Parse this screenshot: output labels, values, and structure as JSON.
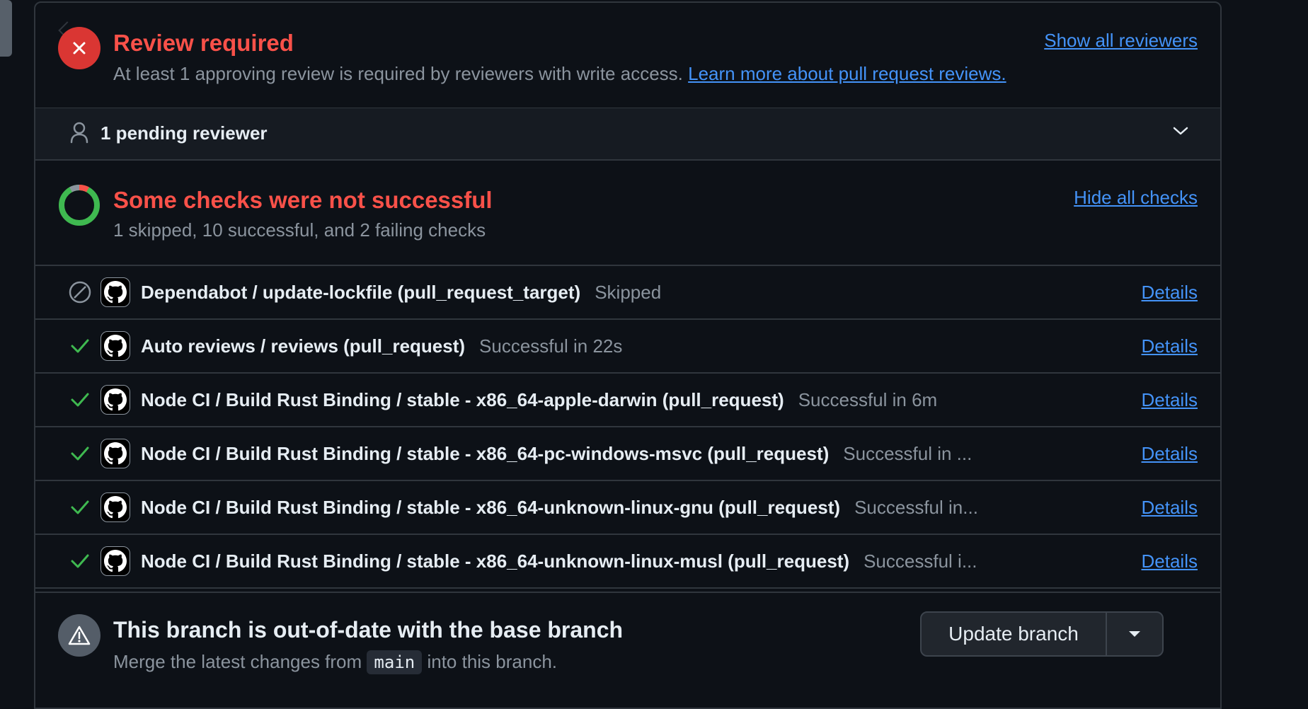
{
  "review": {
    "title": "Review required",
    "description": "At least 1 approving review is required by reviewers with write access.",
    "learn_more": "Learn more about pull request reviews.",
    "show_all": "Show all reviewers",
    "pending": "1 pending reviewer"
  },
  "checks": {
    "title": "Some checks were not successful",
    "summary": "1 skipped, 10 successful, and 2 failing checks",
    "hide_all": "Hide all checks",
    "items": [
      {
        "name": "Dependabot / update-lockfile (pull_request_target)",
        "status_text": "Skipped",
        "state": "skipped",
        "details": "Details"
      },
      {
        "name": "Auto reviews / reviews (pull_request)",
        "status_text": "Successful in 22s",
        "state": "success",
        "details": "Details"
      },
      {
        "name": "Node CI / Build Rust Binding / stable - x86_64-apple-darwin (pull_request)",
        "status_text": "Successful in 6m",
        "state": "success",
        "details": "Details"
      },
      {
        "name": "Node CI / Build Rust Binding / stable - x86_64-pc-windows-msvc (pull_request)",
        "status_text": "Successful in ...",
        "state": "success",
        "details": "Details"
      },
      {
        "name": "Node CI / Build Rust Binding / stable - x86_64-unknown-linux-gnu (pull_request)",
        "status_text": "Successful in...",
        "state": "success",
        "details": "Details"
      },
      {
        "name": "Node CI / Build Rust Binding / stable - x86_64-unknown-linux-musl (pull_request)",
        "status_text": "Successful i...",
        "state": "success",
        "details": "Details"
      }
    ]
  },
  "branch": {
    "title": "This branch is out-of-date with the base branch",
    "desc_prefix": "Merge the latest changes from",
    "base_branch": "main",
    "desc_suffix": "into this branch.",
    "update_label": "Update branch"
  },
  "colors": {
    "danger": "#f85149",
    "accent": "#4493f8",
    "success": "#3fb950",
    "muted": "#8b949e"
  }
}
